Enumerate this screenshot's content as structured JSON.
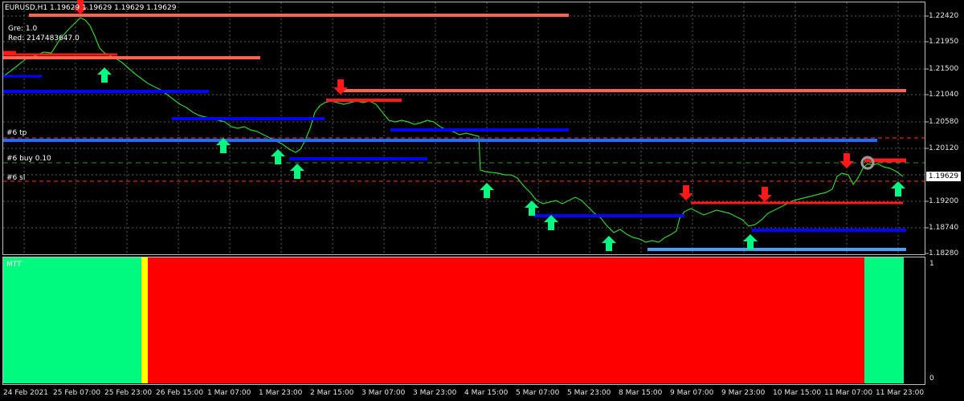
{
  "chart": {
    "header": "EURUSD,H1  1.19629 1.19629 1.19629 1.19629",
    "info_lines": [
      "Gre: 1.0",
      "Red: 2147483647.0"
    ],
    "order_labels": {
      "tp": "#6 tp",
      "buy": "#6 buy 0.10",
      "sl": "#6 sl"
    },
    "current_price": "1.19629",
    "price_ticks": [
      "1.22420",
      "1.21950",
      "1.21500",
      "1.21040",
      "1.20580",
      "1.20120",
      "1.19200",
      "1.18740",
      "1.18280"
    ],
    "indicator_name": "MTT",
    "indicator_ticks": [
      "1",
      "0"
    ],
    "time_ticks": [
      "24 Feb 2021",
      "25 Feb 07:00",
      "25 Feb 23:00",
      "26 Feb 15:00",
      "1 Mar 07:00",
      "1 Mar 23:00",
      "2 Mar 15:00",
      "3 Mar 07:00",
      "3 Mar 23:00",
      "4 Mar 15:00",
      "5 Mar 07:00",
      "5 Mar 23:00",
      "8 Mar 15:00",
      "9 Mar 07:00",
      "9 Mar 23:00",
      "10 Mar 15:00",
      "11 Mar 07:00",
      "11 Mar 23:00"
    ],
    "colors": {
      "candle": "#32cd32",
      "buy_arrow": "#00ff7f",
      "sell_arrow": "#ff0000",
      "support_line": "#0000ff",
      "resist_line": "#ff6347",
      "ind_green": "#00fa80",
      "ind_red": "#ff0000",
      "ind_yellow": "#ffff00"
    }
  }
}
